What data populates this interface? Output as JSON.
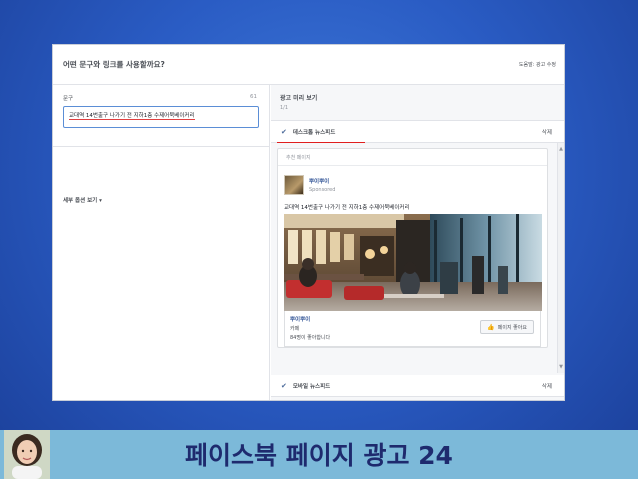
{
  "panel": {
    "title": "어떤 문구와 링크를 사용할까요?",
    "help": "도움말: 광고 수정"
  },
  "text_field": {
    "label": "문구",
    "count": "61",
    "value": "교대역 14번출구 나가기 전 지하1층 수제어묵베이커리"
  },
  "more_options": "세부 옵션 보기 ▾",
  "preview": {
    "title": "광고 미리 보기",
    "page": "1/1",
    "desktop": {
      "label": "데스크톱 뉴스피드",
      "remove": "삭제"
    },
    "mobile": {
      "label": "모바일 뉴스피드",
      "remove": "삭제"
    }
  },
  "ad": {
    "suggested": "추천 페이지",
    "page_name": "뿌이뿌이",
    "sponsored": "Sponsored",
    "text": "교대역 14번출구 나가기 전 지하1층 수제어묵베이커리",
    "foot_name": "뿌이뿌이",
    "category": "카페",
    "likes": "84명이 좋아합니다",
    "like_button": "페이지 좋아요"
  },
  "icons": {
    "check": "checkmark-icon",
    "like": "thumbs-up-icon"
  },
  "slide": {
    "title": "페이스북 페이지 광고 24",
    "footer_color": "#7cb9d9",
    "title_color": "#1e2a6e"
  }
}
